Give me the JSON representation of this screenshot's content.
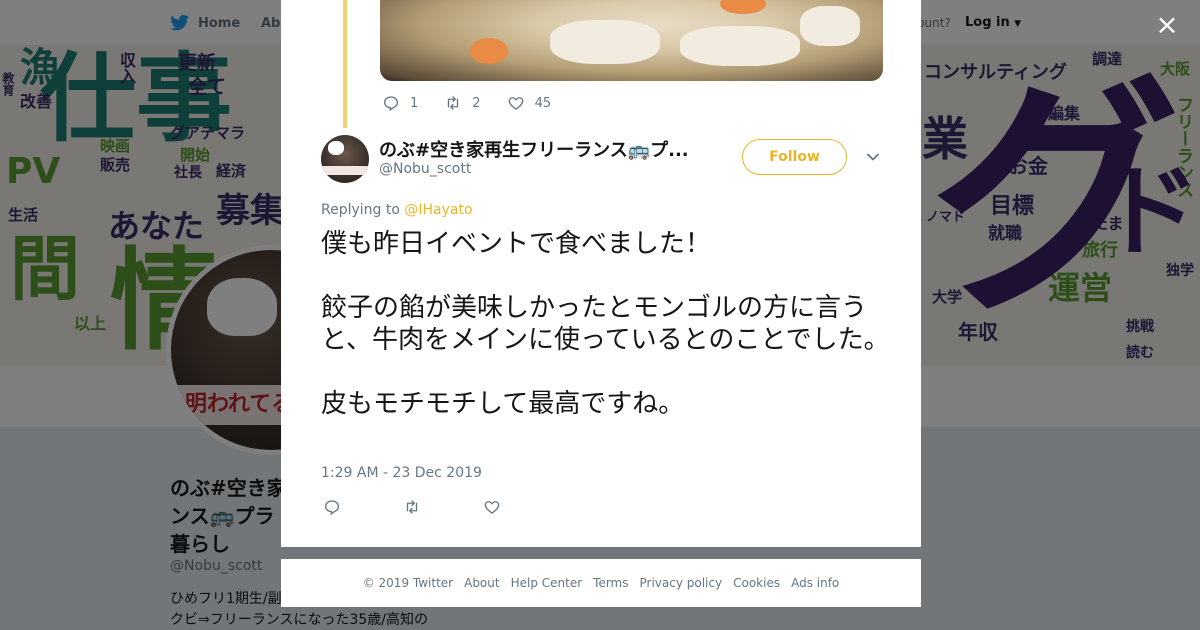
{
  "nav": {
    "home_label": "Home",
    "about_label": "Abo",
    "account_prompt": "ccount?",
    "login_label": "Log in"
  },
  "banner": {
    "words": [
      "仕事",
      "更新",
      "全て",
      "収入",
      "漁",
      "改善",
      "教育",
      "グアテマラ",
      "映画",
      "販売",
      "開始",
      "社長",
      "経済",
      "PV",
      "生活",
      "あなた",
      "募集",
      "以上",
      "間",
      "情",
      "コンサルティング",
      "大阪",
      "調達",
      "編集",
      "業",
      "お金",
      "目標",
      "就職",
      "たま",
      "旅行",
      "運営",
      "年収",
      "大学",
      "挑戦",
      "読む",
      "独学",
      "ノマド",
      "フリーランス",
      "グ",
      "ド"
    ]
  },
  "profile": {
    "avatar_band_text": "明われてる",
    "display_name": "のぶ#空き家再生フリーランス🚌プラ暮らし",
    "name_line1": "のぶ#空き家",
    "name_line2": "ンス🚌プラ",
    "name_line3": "暮らし",
    "handle": "@Nobu_scott",
    "bio_line1": "ひめフリ1期生/副",
    "bio_line2": "クビ⇒フリーランスになった35歳/高知の"
  },
  "modal": {
    "close_label": "×",
    "parent_tweet": {
      "reply_count": "1",
      "retweet_count": "2",
      "like_count": "45"
    },
    "tweet": {
      "author_name": "のぶ#空き家再生フリーランス🚌プ...",
      "author_handle": "@Nobu_scott",
      "follow_label": "Follow",
      "replying_prefix": "Replying to",
      "replying_to": "@IHayato",
      "text": "僕も昨日イベントで食べました！\n\n餃子の餡が美味しかったとモンゴルの方に言うと、牛肉をメインに使っているとのことでした。\n\n皮もモチモチして最高ですね。",
      "timestamp": "1:29 AM - 23 Dec 2019"
    }
  },
  "footer": {
    "links": [
      "© 2019 Twitter",
      "About",
      "Help Center",
      "Terms",
      "Privacy policy",
      "Cookies",
      "Ads info"
    ]
  },
  "colors": {
    "accent": "#e8b52a",
    "thread_line": "#f5d27a",
    "muted_text": "#657786",
    "twitter_blue": "#1da1f2"
  }
}
